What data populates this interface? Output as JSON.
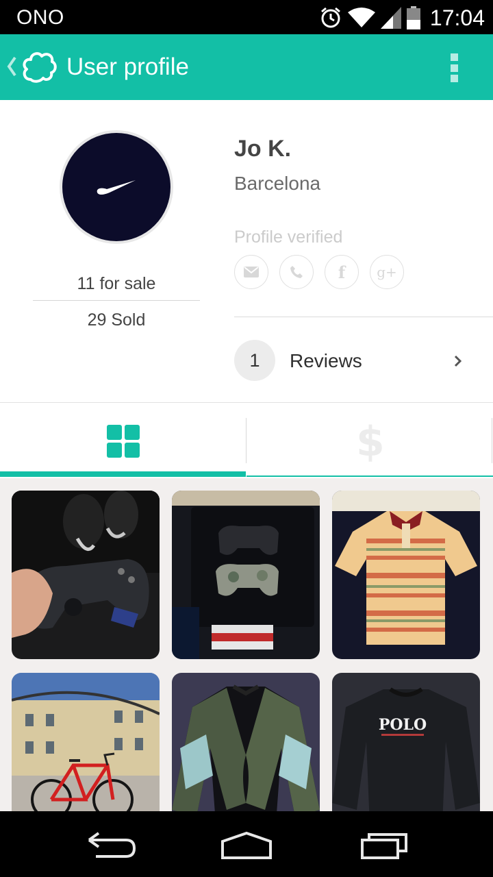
{
  "status_bar": {
    "carrier": "ONO",
    "time": "17:04",
    "icons": [
      "alarm-icon",
      "wifi-icon",
      "signal-icon",
      "battery-icon"
    ]
  },
  "app_bar": {
    "title": "User profile",
    "icons": [
      "back-icon",
      "logo-icon",
      "overflow-menu-icon"
    ],
    "color": "#13bfa6"
  },
  "profile": {
    "name": "Jo K.",
    "city": "Barcelona",
    "for_sale": "11 for sale",
    "sold": "29 Sold",
    "verified_label": "Profile verified",
    "verification_icons": [
      "mail-icon",
      "phone-icon",
      "facebook-icon",
      "google-plus-icon"
    ],
    "reviews_count": "1",
    "reviews_label": "Reviews"
  },
  "tabs": [
    {
      "icon": "grid-icon",
      "active": true
    },
    {
      "icon": "dollar-icon",
      "active": false
    }
  ],
  "products": [
    {
      "subject": "PS4 controller"
    },
    {
      "subject": "PS3 console with controllers and games"
    },
    {
      "subject": "Striped polo shirt"
    },
    {
      "subject": "Red road bicycle"
    },
    {
      "subject": "Camouflage sweatshirt"
    },
    {
      "subject": "Black POLO sweatshirt",
      "print": "POLO"
    }
  ],
  "nav_bar": {
    "icons": [
      "back-nav-icon",
      "home-nav-icon",
      "recents-nav-icon"
    ]
  }
}
